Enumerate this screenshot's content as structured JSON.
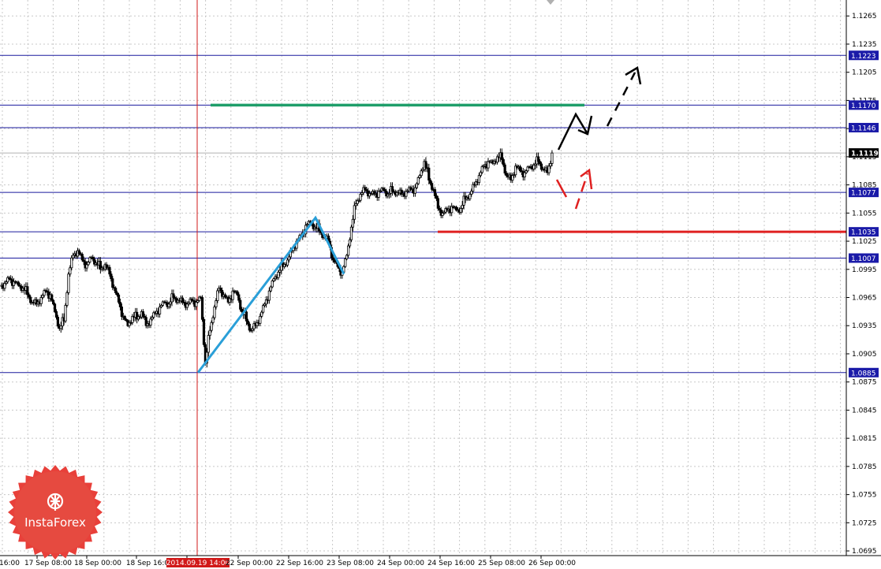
{
  "chart_data": {
    "type": "candlestick",
    "instrument_note": "",
    "y_axis": {
      "range": [
        1.069,
        1.1282
      ],
      "tick_labels": [
        "1.1265",
        "1.1235",
        "1.1205",
        "1.1175",
        "1.1145",
        "1.1115",
        "1.1085",
        "1.1055",
        "1.1025",
        "1.0995",
        "1.0965",
        "1.0935",
        "1.0905",
        "1.0875",
        "1.0845",
        "1.0815",
        "1.0785",
        "1.0755",
        "1.0725",
        "1.0695"
      ]
    },
    "x_axis": {
      "tick_labels": [
        "16:00",
        "17 Sep 08:00",
        "18 Sep 00:00",
        "18 Sep 16:0",
        "2014.09.19 14:00",
        "22 Sep 00:00",
        "22 Sep 16:00",
        "23 Sep 08:00",
        "24 Sep 00:00",
        "24 Sep 16:00",
        "25 Sep 08:00",
        "26 Sep 00:00"
      ],
      "highlighted_label": "2014.09.19 14:00"
    },
    "horizontal_levels": [
      {
        "value": 1.1223,
        "label": "1.1223"
      },
      {
        "value": 1.117,
        "label": "1.1170"
      },
      {
        "value": 1.1146,
        "label": "1.1146"
      },
      {
        "value": 1.1077,
        "label": "1.1077"
      },
      {
        "value": 1.1035,
        "label": "1.1035"
      },
      {
        "value": 1.1007,
        "label": "1.1007"
      },
      {
        "value": 1.0885,
        "label": "1.0885"
      }
    ],
    "current_price": {
      "value": 1.1119,
      "label": "1.1119"
    },
    "zones": {
      "green_target": 1.117,
      "red_support": 1.1035
    },
    "zigzag_points": [
      {
        "bar": 0,
        "price": 1.0885
      },
      {
        "bar": 1,
        "price": 1.105
      },
      {
        "bar": 2,
        "price": 1.099
      }
    ],
    "close_path": [
      1.098,
      1.0985,
      1.0982,
      1.0978,
      1.0975,
      1.0968,
      1.096,
      1.0958,
      1.0965,
      1.0972,
      1.0968,
      1.095,
      1.0932,
      1.094,
      1.099,
      1.101,
      1.1015,
      1.1005,
      1.1,
      1.1008,
      1.1002,
      1.0995,
      1.1,
      1.099,
      1.0975,
      1.096,
      1.0945,
      1.0935,
      1.0945,
      1.0942,
      1.095,
      1.0935,
      1.0942,
      1.0948,
      1.0955,
      1.096,
      1.0958,
      1.0965,
      1.0962,
      1.096,
      1.0958,
      1.0962,
      1.096,
      1.0965,
      1.0895,
      1.093,
      1.0955,
      1.0975,
      1.0968,
      1.096,
      1.0972,
      1.0968,
      1.095,
      1.094,
      1.093,
      1.0935,
      1.0945,
      1.0958,
      1.0972,
      1.0985,
      1.0992,
      1.0998,
      1.1005,
      1.1015,
      1.1025,
      1.103,
      1.1042,
      1.1045,
      1.104,
      1.1036,
      1.103,
      1.1025,
      1.1005,
      1.0998,
      1.0992,
      1.101,
      1.104,
      1.1065,
      1.1075,
      1.108,
      1.1076,
      1.1075,
      1.1078,
      1.108,
      1.1075,
      1.1078,
      1.1077,
      1.1075,
      1.1078,
      1.108,
      1.1082,
      1.1095,
      1.111,
      1.109,
      1.108,
      1.106,
      1.1055,
      1.1058,
      1.1062,
      1.1058,
      1.106,
      1.107,
      1.1075,
      1.1085,
      1.1095,
      1.1105,
      1.111,
      1.1108,
      1.1115,
      1.1112,
      1.1095,
      1.109,
      1.1105,
      1.11,
      1.1098,
      1.1104,
      1.1106,
      1.111,
      1.1102,
      1.1098,
      1.1119
    ]
  },
  "logo": {
    "text": "InstaForex"
  }
}
